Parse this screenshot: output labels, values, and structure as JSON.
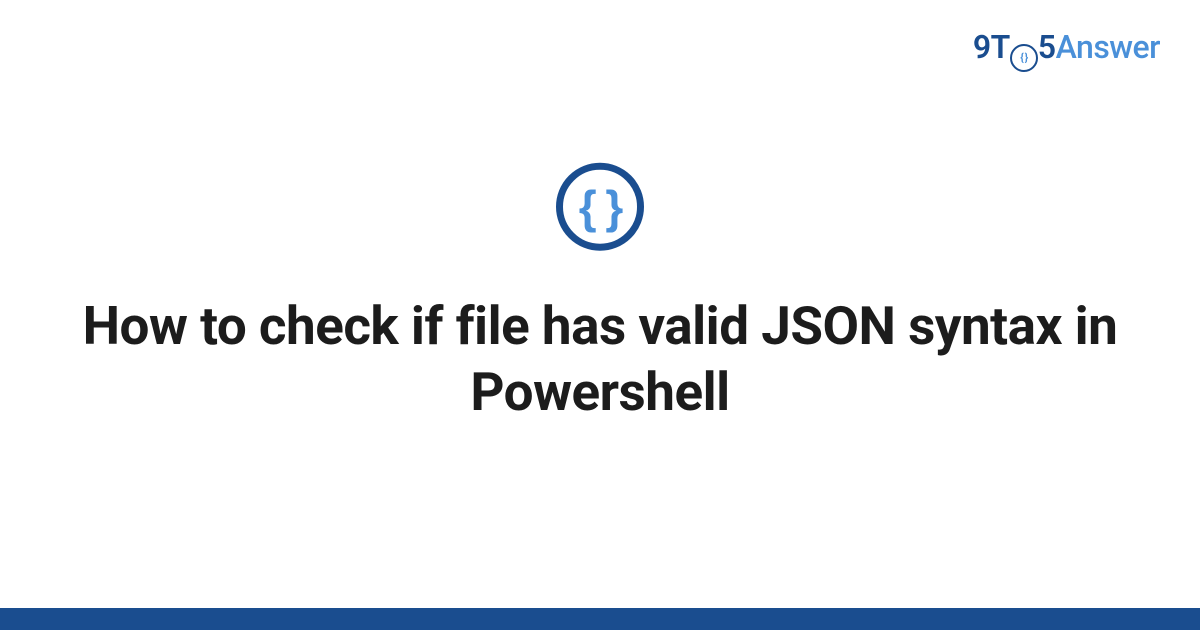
{
  "logo": {
    "part1": "9T",
    "part2": "5",
    "part3": "Answer"
  },
  "icon": {
    "glyph": "{ }",
    "name": "json-braces-icon"
  },
  "title": "How to check if file has valid JSON syntax in Powershell",
  "colors": {
    "brand_dark": "#1a4d8f",
    "brand_light": "#4a90d9",
    "text": "#1c1c1c"
  }
}
